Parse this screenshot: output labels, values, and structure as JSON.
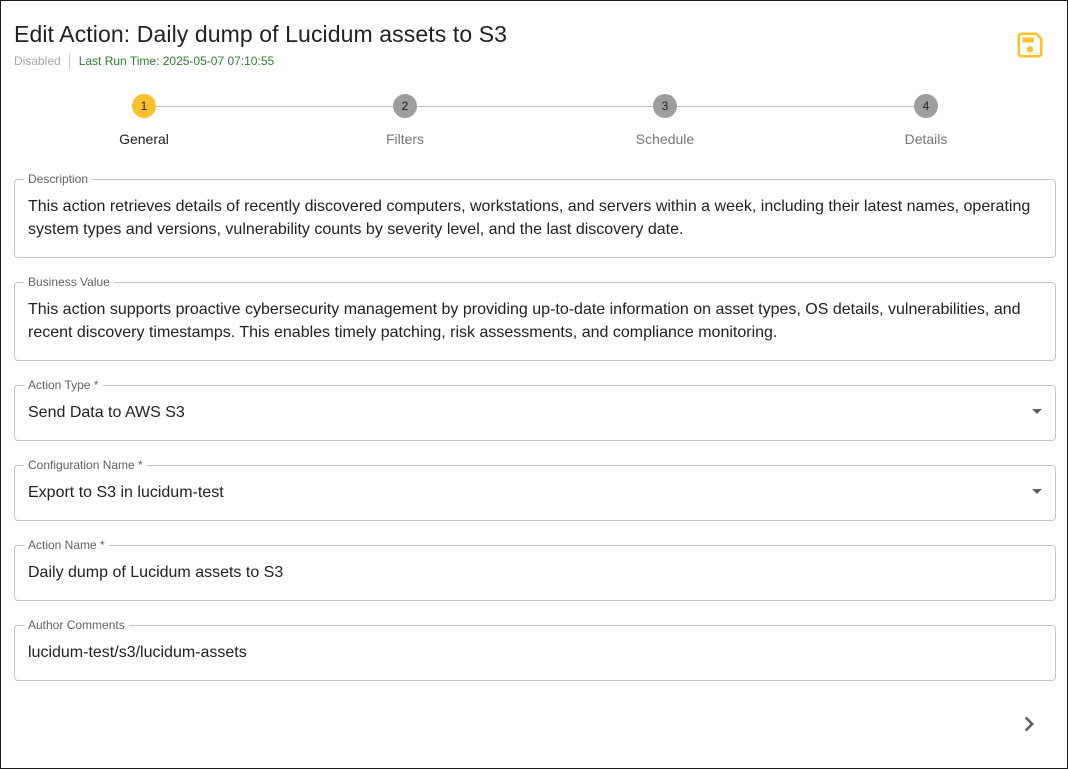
{
  "header": {
    "title": "Edit Action: Daily dump of Lucidum assets to S3",
    "status": "Disabled",
    "last_run": "Last Run Time: 2025-05-07 07:10:55",
    "save_icon": "save-icon",
    "accent_color": "#fbc02d"
  },
  "stepper": {
    "steps": [
      {
        "number": "1",
        "label": "General"
      },
      {
        "number": "2",
        "label": "Filters"
      },
      {
        "number": "3",
        "label": "Schedule"
      },
      {
        "number": "4",
        "label": "Details"
      }
    ],
    "active_step": "1"
  },
  "form": {
    "description": {
      "label": "Description",
      "value": "This action retrieves details of recently discovered computers, workstations, and servers within a week, including their latest names, operating system types and versions, vulnerability counts by severity level, and the last discovery date."
    },
    "business_value": {
      "label": "Business Value",
      "value": "This action supports proactive cybersecurity management by providing up-to-date information on asset types, OS details, vulnerabilities, and recent discovery timestamps. This enables timely patching, risk assessments, and compliance monitoring."
    },
    "action_type": {
      "label": "Action Type *",
      "value": "Send Data to AWS S3"
    },
    "configuration_name": {
      "label": "Configuration Name *",
      "value": "Export to S3 in lucidum-test"
    },
    "action_name": {
      "label": "Action Name *",
      "value": "Daily dump of Lucidum assets to S3"
    },
    "author_comments": {
      "label": "Author Comments",
      "value": "lucidum-test/s3/lucidum-assets"
    }
  },
  "footer": {
    "next_icon": "chevron-right-icon"
  }
}
